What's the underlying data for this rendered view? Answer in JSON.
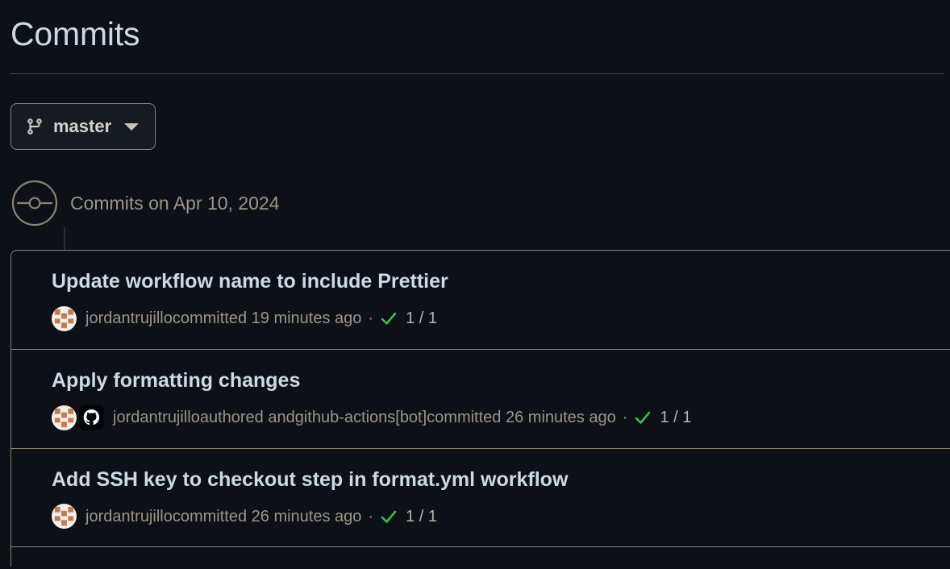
{
  "header": {
    "title": "Commits"
  },
  "branch_selector": {
    "icon": "git-branch-icon",
    "label": "master",
    "chevron": "chevron-down-icon"
  },
  "group": {
    "node_icon": "git-commit-icon",
    "date_label": "Commits on Apr 10, 2024"
  },
  "commits": [
    {
      "title": "Update workflow name to include Prettier",
      "avatars": [
        "identicon-avatar"
      ],
      "author": "jordantrujillo",
      "meta_action": " committed 19 minutes ago ",
      "dot": "·",
      "status_icon": "check-icon",
      "checks": "1 / 1"
    },
    {
      "title": "Apply formatting changes",
      "avatars": [
        "identicon-avatar",
        "github-octocat-avatar"
      ],
      "author": "jordantrujillo",
      "meta_middle": " authored and ",
      "coauthor": "github-actions[bot]",
      "meta_action": " committed 26 minutes ago ",
      "dot": "·",
      "status_icon": "check-icon",
      "checks": "1 / 1"
    },
    {
      "title": "Add SSH key to checkout step in format.yml workflow",
      "avatars": [
        "identicon-avatar"
      ],
      "author": "jordantrujillo",
      "meta_action": " committed 26 minutes ago ",
      "dot": "·",
      "status_icon": "check-icon",
      "checks": "1 / 1"
    }
  ],
  "colors": {
    "background": "#0d1117",
    "title_text": "#cdd9e5",
    "muted_text": "#9d9488",
    "border": "#8c8276",
    "check_green": "#3fb950",
    "identicon_fg": "#c07a54",
    "identicon_bg": "#f4efe9"
  }
}
